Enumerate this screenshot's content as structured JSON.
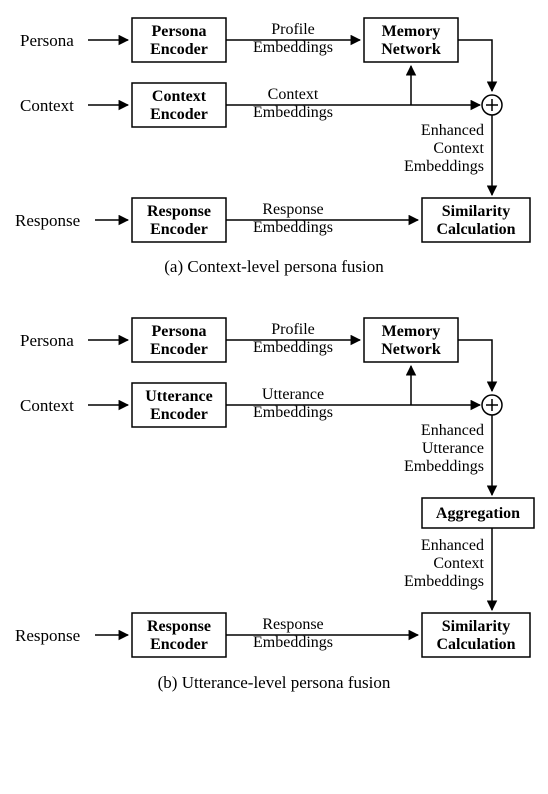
{
  "diagram_a": {
    "caption": "(a) Context-level persona fusion",
    "inputs": {
      "persona": "Persona",
      "context": "Context",
      "response": "Response"
    },
    "boxes": {
      "persona_encoder_l1": "Persona",
      "persona_encoder_l2": "Encoder",
      "context_encoder_l1": "Context",
      "context_encoder_l2": "Encoder",
      "response_encoder_l1": "Response",
      "response_encoder_l2": "Encoder",
      "memory_network_l1": "Memory",
      "memory_network_l2": "Network",
      "similarity_l1": "Similarity",
      "similarity_l2": "Calculation"
    },
    "edges": {
      "profile_emb_l1": "Profile",
      "profile_emb_l2": "Embeddings",
      "context_emb_l1": "Context",
      "context_emb_l2": "Embeddings",
      "response_emb_l1": "Response",
      "response_emb_l2": "Embeddings",
      "enhanced_ctx_l1": "Enhanced",
      "enhanced_ctx_l2": "Context",
      "enhanced_ctx_l3": "Embeddings"
    }
  },
  "diagram_b": {
    "caption": "(b) Utterance-level persona fusion",
    "inputs": {
      "persona": "Persona",
      "context": "Context",
      "response": "Response"
    },
    "boxes": {
      "persona_encoder_l1": "Persona",
      "persona_encoder_l2": "Encoder",
      "utterance_encoder_l1": "Utterance",
      "utterance_encoder_l2": "Encoder",
      "response_encoder_l1": "Response",
      "response_encoder_l2": "Encoder",
      "memory_network_l1": "Memory",
      "memory_network_l2": "Network",
      "aggregation": "Aggregation",
      "similarity_l1": "Similarity",
      "similarity_l2": "Calculation"
    },
    "edges": {
      "profile_emb_l1": "Profile",
      "profile_emb_l2": "Embeddings",
      "utterance_emb_l1": "Utterance",
      "utterance_emb_l2": "Embeddings",
      "response_emb_l1": "Response",
      "response_emb_l2": "Embeddings",
      "enhanced_utt_l1": "Enhanced",
      "enhanced_utt_l2": "Utterance",
      "enhanced_utt_l3": "Embeddings",
      "enhanced_ctx_l1": "Enhanced",
      "enhanced_ctx_l2": "Context",
      "enhanced_ctx_l3": "Embeddings"
    }
  }
}
